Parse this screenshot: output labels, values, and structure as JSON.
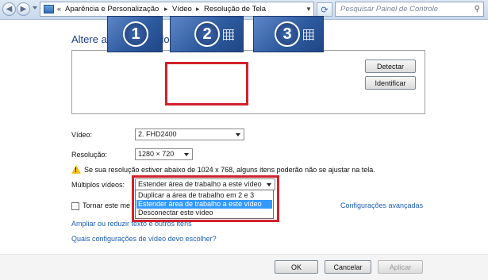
{
  "address_bar": {
    "breadcrumbs": [
      "Aparência e Personalização",
      "Vídeo",
      "Resolução de Tela"
    ],
    "search_placeholder": "Pesquisar Painel de Controle"
  },
  "page_title": "Altere a aparência dos vídeos",
  "monitors": [
    {
      "number": "1",
      "selected": false
    },
    {
      "number": "2",
      "selected": true
    },
    {
      "number": "3",
      "selected": false
    }
  ],
  "side_buttons": {
    "detect": "Detectar",
    "identify": "Identificar"
  },
  "form": {
    "display_label": "Vídeo:",
    "display_value": "2. FHD2400",
    "resolution_label": "Resolução:",
    "resolution_value": "1280 × 720",
    "warning_text": "Se sua resolução estiver abaixo de 1024 x 768, alguns itens poderão não se ajustar na tela.",
    "multiple_label": "Múltiplos vídeos:",
    "multiple_value": "Estender área de trabalho a este vídeo",
    "multiple_options": [
      "Duplicar a área de trabalho em 2 e 3",
      "Estender área de trabalho a este vídeo",
      "Desconectar este vídeo"
    ],
    "primary_checkbox_label": "Tornar este me",
    "advanced_link": "Configurações avançadas"
  },
  "links": {
    "text_size": "Ampliar ou reduzir texto e outros itens",
    "which_settings": "Quais configurações de vídeo devo escolher?"
  },
  "footer_buttons": {
    "ok": "OK",
    "cancel": "Cancelar",
    "apply": "Aplicar"
  },
  "colors": {
    "highlight_red": "#d3212d",
    "selection_blue": "#3399ff",
    "title_blue": "#1e3f8a",
    "link_blue": "#1e5fb5"
  }
}
